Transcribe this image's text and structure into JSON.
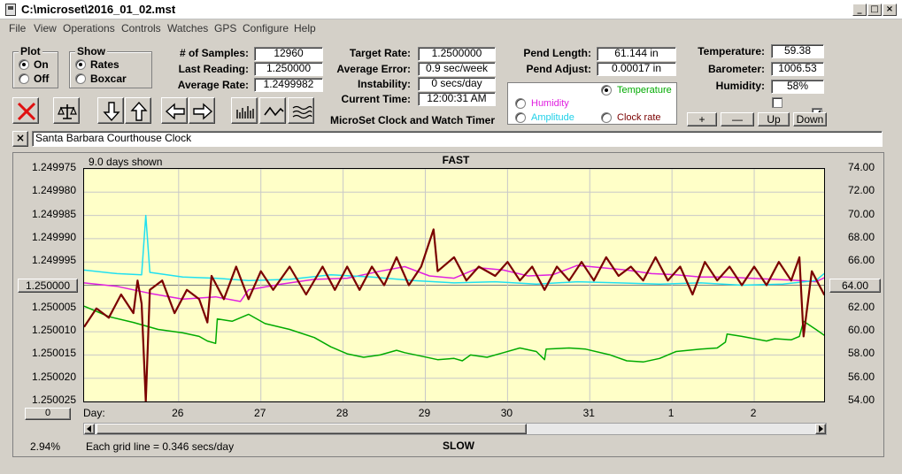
{
  "window": {
    "title": "C:\\microset\\2016_01_02.mst",
    "min": "_",
    "max": "□",
    "close": "×"
  },
  "menu": [
    "File",
    "View",
    "Operations",
    "Controls",
    "Watches",
    "GPS",
    "Configure",
    "Help"
  ],
  "plot_group": {
    "title": "Plot",
    "on": "On",
    "off": "Off",
    "selected": "On"
  },
  "show_group": {
    "title": "Show",
    "rates": "Rates",
    "boxcar": "Boxcar",
    "selected": "Rates"
  },
  "stats": {
    "samples_label": "# of Samples:",
    "samples": "12960",
    "last_label": "Last Reading:",
    "last": "1.250000",
    "avg_label": "Average Rate:",
    "avg": "1.2499982",
    "target_label": "Target Rate:",
    "target": "1.2500000",
    "avgerr_label": "Average Error:",
    "avgerr": "0.9 sec/week",
    "instab_label": "Instability:",
    "instab": "0 secs/day",
    "time_label": "Current Time:",
    "time": "12:00:31 AM",
    "pendlen_label": "Pend Length:",
    "pendlen": "61.144 in",
    "pendadj_label": "Pend Adjust:",
    "pendadj": "0.00017 in",
    "temp_label": "Temperature:",
    "temp": "59.38",
    "baro_label": "Barometer:",
    "baro": "1006.53",
    "hum_label": "Humidity:",
    "hum": "58%"
  },
  "app_caption": "MicroSet Clock and Watch Timer",
  "sensor_options": {
    "temperature": "Temperature",
    "humidity": "Humidity",
    "amplitude": "Amplitude",
    "clock_rate": "Clock rate",
    "selected": "Temperature"
  },
  "adjust_buttons": {
    "plus": "+",
    "minus": "—",
    "up": "Up",
    "down": "Down"
  },
  "clock_name": "Santa Barbara Courthouse Clock",
  "clear_btn": "×",
  "colors": {
    "plot_bg": "#ffffc8",
    "rate": "#7a0000",
    "temperature": "#00aa00",
    "humidity": "#e020e0",
    "amplitude": "#20e0f0",
    "grid": "#c8c8c8"
  },
  "chart_data": {
    "type": "line",
    "days_shown": "9.0 days shown",
    "top_label": "FAST",
    "bottom_label": "SLOW",
    "grid_note": "Each grid line = 0.346 secs/day",
    "percent": "2.94%",
    "day_axis_label": "Day:",
    "left_ticks": [
      "1.249975",
      "1.249980",
      "1.249985",
      "1.249990",
      "1.249995",
      "1.250000",
      "1.250005",
      "1.250010",
      "1.250015",
      "1.250020",
      "1.250025"
    ],
    "right_ticks": [
      "74.00",
      "72.00",
      "70.00",
      "68.00",
      "66.00",
      "64.00",
      "62.00",
      "60.00",
      "58.00",
      "56.00",
      "54.00"
    ],
    "left_ylim": [
      1.249975,
      1.250025
    ],
    "right_ylim": [
      54,
      74
    ],
    "left_marker": "1.250000",
    "right_marker": "64.00",
    "bottom_left_button": "0",
    "day_labels": [
      "26",
      "27",
      "28",
      "29",
      "30",
      "31",
      "1",
      "2"
    ],
    "x_range_days": [
      0,
      9.0
    ],
    "day_positions": [
      1.15,
      2.15,
      3.15,
      4.15,
      5.15,
      6.15,
      7.15,
      8.15
    ],
    "series": [
      {
        "name": "Temperature",
        "axis": "right",
        "color": "#00aa00",
        "points": [
          [
            0,
            62.2
          ],
          [
            0.3,
            61.3
          ],
          [
            0.6,
            60.8
          ],
          [
            0.9,
            60.2
          ],
          [
            1.2,
            59.9
          ],
          [
            1.4,
            59.6
          ],
          [
            1.5,
            59.2
          ],
          [
            1.6,
            59.0
          ],
          [
            1.62,
            61.1
          ],
          [
            1.8,
            60.9
          ],
          [
            2.0,
            61.5
          ],
          [
            2.2,
            60.7
          ],
          [
            2.5,
            60.2
          ],
          [
            2.8,
            59.5
          ],
          [
            3.0,
            58.7
          ],
          [
            3.2,
            58.1
          ],
          [
            3.4,
            57.8
          ],
          [
            3.6,
            58.0
          ],
          [
            3.8,
            58.4
          ],
          [
            3.9,
            58.2
          ],
          [
            4.1,
            57.9
          ],
          [
            4.3,
            57.6
          ],
          [
            4.5,
            57.7
          ],
          [
            4.6,
            57.5
          ],
          [
            4.7,
            58.0
          ],
          [
            4.9,
            57.8
          ],
          [
            5.1,
            58.2
          ],
          [
            5.3,
            58.6
          ],
          [
            5.5,
            58.3
          ],
          [
            5.6,
            57.6
          ],
          [
            5.62,
            58.5
          ],
          [
            5.9,
            58.6
          ],
          [
            6.1,
            58.5
          ],
          [
            6.4,
            58.0
          ],
          [
            6.6,
            57.5
          ],
          [
            6.8,
            57.4
          ],
          [
            7.0,
            57.7
          ],
          [
            7.2,
            58.3
          ],
          [
            7.5,
            58.5
          ],
          [
            7.7,
            58.6
          ],
          [
            7.8,
            59.1
          ],
          [
            7.82,
            59.8
          ],
          [
            8.0,
            59.6
          ],
          [
            8.3,
            59.2
          ],
          [
            8.4,
            59.4
          ],
          [
            8.6,
            59.3
          ],
          [
            8.7,
            59.6
          ],
          [
            8.75,
            60.9
          ],
          [
            8.9,
            60.2
          ],
          [
            9.0,
            59.7
          ],
          [
            9.2,
            59.5
          ]
        ]
      },
      {
        "name": "Humidity",
        "axis": "right",
        "color": "#e020e0",
        "points": [
          [
            0,
            64.2
          ],
          [
            0.4,
            63.9
          ],
          [
            0.8,
            63.3
          ],
          [
            1.2,
            62.8
          ],
          [
            1.6,
            63.0
          ],
          [
            1.9,
            62.6
          ],
          [
            2.0,
            63.6
          ],
          [
            2.4,
            64.1
          ],
          [
            2.8,
            64.5
          ],
          [
            3.2,
            64.6
          ],
          [
            3.6,
            65.2
          ],
          [
            3.9,
            65.6
          ],
          [
            4.2,
            64.8
          ],
          [
            4.5,
            64.6
          ],
          [
            4.8,
            65.5
          ],
          [
            5.1,
            65.3
          ],
          [
            5.4,
            64.8
          ],
          [
            5.7,
            64.9
          ],
          [
            6.0,
            65.7
          ],
          [
            6.3,
            65.5
          ],
          [
            6.6,
            65.3
          ],
          [
            6.9,
            65.0
          ],
          [
            7.2,
            64.9
          ],
          [
            7.5,
            64.7
          ],
          [
            7.8,
            64.7
          ],
          [
            8.1,
            64.6
          ],
          [
            8.4,
            64.5
          ],
          [
            8.7,
            64.4
          ],
          [
            8.9,
            64.3
          ],
          [
            9.05,
            64.8
          ],
          [
            9.2,
            65.6
          ]
        ]
      },
      {
        "name": "Amplitude",
        "axis": "right",
        "color": "#20e0f0",
        "points": [
          [
            0,
            65.3
          ],
          [
            0.4,
            65.0
          ],
          [
            0.7,
            64.9
          ],
          [
            0.75,
            70.0
          ],
          [
            0.8,
            65.1
          ],
          [
            1.2,
            64.7
          ],
          [
            1.6,
            64.6
          ],
          [
            2.0,
            64.4
          ],
          [
            2.5,
            64.5
          ],
          [
            3.0,
            64.9
          ],
          [
            3.5,
            64.7
          ],
          [
            4.0,
            64.4
          ],
          [
            4.5,
            64.2
          ],
          [
            5.0,
            64.3
          ],
          [
            5.5,
            64.1
          ],
          [
            6.0,
            64.3
          ],
          [
            6.5,
            64.2
          ],
          [
            7.0,
            64.1
          ],
          [
            7.5,
            64.2
          ],
          [
            8.0,
            64.0
          ],
          [
            8.5,
            64.1
          ],
          [
            8.9,
            64.4
          ],
          [
            9.0,
            65.0
          ],
          [
            9.2,
            64.5
          ]
        ]
      },
      {
        "name": "Rate",
        "axis": "left",
        "color": "#7a0000",
        "points": [
          [
            0,
            1.250009
          ],
          [
            0.15,
            1.250005
          ],
          [
            0.3,
            1.250007
          ],
          [
            0.45,
            1.250002
          ],
          [
            0.6,
            1.250006
          ],
          [
            0.65,
            1.249999
          ],
          [
            0.7,
            1.250004
          ],
          [
            0.75,
            1.25003
          ],
          [
            0.8,
            1.250001
          ],
          [
            0.95,
            1.249999
          ],
          [
            1.1,
            1.250006
          ],
          [
            1.25,
            1.250001
          ],
          [
            1.4,
            1.250003
          ],
          [
            1.5,
            1.250008
          ],
          [
            1.55,
            1.249998
          ],
          [
            1.7,
            1.250003
          ],
          [
            1.85,
            1.249996
          ],
          [
            2.0,
            1.250003
          ],
          [
            2.15,
            1.249997
          ],
          [
            2.3,
            1.250001
          ],
          [
            2.5,
            1.249996
          ],
          [
            2.7,
            1.250002
          ],
          [
            2.9,
            1.249996
          ],
          [
            3.05,
            1.250001
          ],
          [
            3.2,
            1.249996
          ],
          [
            3.35,
            1.250001
          ],
          [
            3.5,
            1.249996
          ],
          [
            3.65,
            1.25
          ],
          [
            3.8,
            1.249994
          ],
          [
            3.95,
            1.25
          ],
          [
            4.1,
            1.249996
          ],
          [
            4.25,
            1.249988
          ],
          [
            4.3,
            1.249997
          ],
          [
            4.5,
            1.249994
          ],
          [
            4.65,
            1.249999
          ],
          [
            4.8,
            1.249996
          ],
          [
            5.0,
            1.249998
          ],
          [
            5.15,
            1.249995
          ],
          [
            5.3,
            1.249999
          ],
          [
            5.45,
            1.249996
          ],
          [
            5.6,
            1.250001
          ],
          [
            5.75,
            1.249996
          ],
          [
            5.9,
            1.249999
          ],
          [
            6.05,
            1.249995
          ],
          [
            6.2,
            1.249999
          ],
          [
            6.35,
            1.249994
          ],
          [
            6.5,
            1.249998
          ],
          [
            6.65,
            1.249996
          ],
          [
            6.8,
            1.249999
          ],
          [
            6.95,
            1.249994
          ],
          [
            7.1,
            1.249999
          ],
          [
            7.25,
            1.249996
          ],
          [
            7.4,
            1.250002
          ],
          [
            7.55,
            1.249995
          ],
          [
            7.7,
            1.249999
          ],
          [
            7.85,
            1.249996
          ],
          [
            8.0,
            1.25
          ],
          [
            8.15,
            1.249996
          ],
          [
            8.3,
            1.25
          ],
          [
            8.45,
            1.249995
          ],
          [
            8.6,
            1.249999
          ],
          [
            8.7,
            1.249994
          ],
          [
            8.75,
            1.250011
          ],
          [
            8.85,
            1.249997
          ],
          [
            9.0,
            1.250002
          ],
          [
            9.1,
            1.249999
          ],
          [
            9.15,
            1.250004
          ],
          [
            9.25,
            1.250001
          ]
        ]
      }
    ]
  }
}
